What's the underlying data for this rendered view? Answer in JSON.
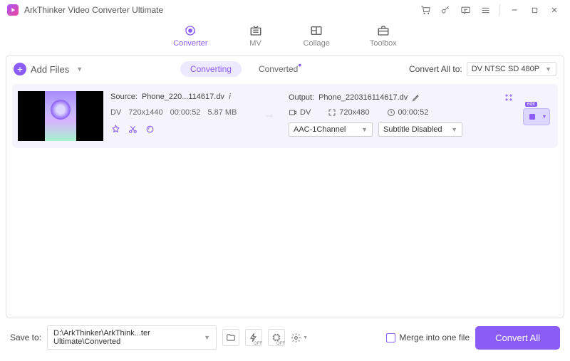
{
  "app": {
    "title": "ArkThinker Video Converter Ultimate"
  },
  "nav": {
    "converter": "Converter",
    "mv": "MV",
    "collage": "Collage",
    "toolbox": "Toolbox"
  },
  "toolbar": {
    "add_files": "Add Files",
    "converting": "Converting",
    "converted": "Converted",
    "convert_all_to": "Convert All to:",
    "format_value": "DV NTSC SD 480P"
  },
  "file": {
    "source_label": "Source:",
    "source_name": "Phone_220...114617.dv",
    "codec": "DV",
    "resolution": "720x1440",
    "duration": "00:00:52",
    "size": "5.87 MB",
    "output_label": "Output:",
    "output_name": "Phone_220316114617.dv",
    "out_codec": "DV",
    "out_resolution": "720x480",
    "out_duration": "00:00:52",
    "audio_select": "AAC-1Channel",
    "subtitle_select": "Subtitle Disabled"
  },
  "bottom": {
    "save_to_label": "Save to:",
    "save_path": "D:\\ArkThinker\\ArkThink...ter Ultimate\\Converted",
    "merge_label": "Merge into one file",
    "convert_all": "Convert All"
  }
}
